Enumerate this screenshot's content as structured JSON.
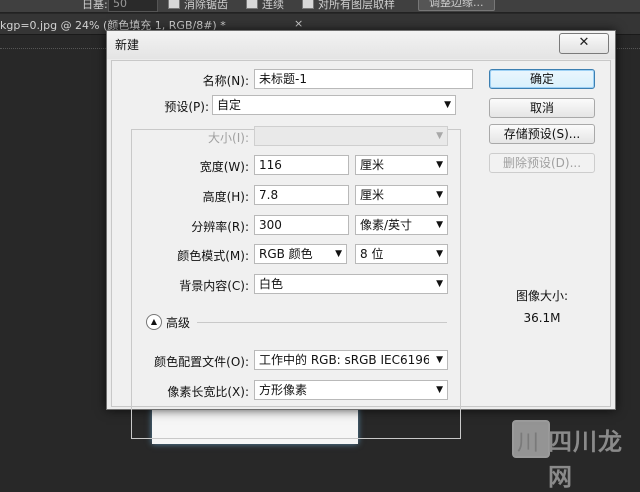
{
  "options_bar": {
    "sample_label": "日基:",
    "sample_value": "50",
    "anti_alias_label": "消除锯齿",
    "contiguous_label": "连续",
    "all_layers_label": "对所有图层取样",
    "refine_edge_button": "调整边缘..."
  },
  "document_tab": {
    "label": "kgp=0.jpg @ 24% (颜色填充 1, RGB/8#) *",
    "close_glyph": "×"
  },
  "dialog": {
    "title": "新建",
    "close_glyph": "✕",
    "name_label": "名称(N):",
    "name_value": "未标题-1",
    "preset_label": "预设(P):",
    "preset_value": "自定",
    "size_label": "大小(I):",
    "size_value": "",
    "width_label": "宽度(W):",
    "width_value": "116",
    "width_unit": "厘米",
    "height_label": "高度(H):",
    "height_value": "7.8",
    "height_unit": "厘米",
    "resolution_label": "分辨率(R):",
    "resolution_value": "300",
    "resolution_unit": "像素/英寸",
    "color_mode_label": "颜色模式(M):",
    "color_mode_value": "RGB 颜色",
    "bit_depth_value": "8 位",
    "background_label": "背景内容(C):",
    "background_value": "白色",
    "advanced_label": "高级",
    "color_profile_label": "颜色配置文件(O):",
    "color_profile_value": "工作中的 RGB: sRGB IEC6196...",
    "pixel_aspect_label": "像素长宽比(X):",
    "pixel_aspect_value": "方形像素",
    "buttons": {
      "ok": "确定",
      "cancel": "取消",
      "save_preset": "存储预设(S)...",
      "delete_preset": "删除预设(D)..."
    },
    "image_size_label": "图像大小:",
    "image_size_value": "36.1M"
  },
  "watermark": {
    "glyph": "川",
    "text": "四川龙网"
  },
  "icons": {
    "dropdown": "chevron-down-icon",
    "advanced_toggle": "double-chevron-up-icon",
    "close": "close-icon"
  }
}
